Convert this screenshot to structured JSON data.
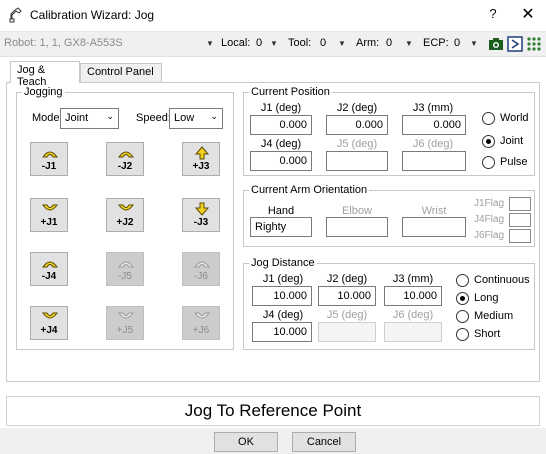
{
  "window": {
    "title": "Calibration Wizard: Jog",
    "help_label": "?",
    "close_label": "✕"
  },
  "toolbar": {
    "robot_label": "Robot:  1, 1, GX8-A553S",
    "local_label": "Local:",
    "local_value": "0",
    "tool_label": "Tool:",
    "tool_value": "0",
    "arm_label": "Arm:",
    "arm_value": "0",
    "ecp_label": "ECP:",
    "ecp_value": "0",
    "icons": [
      "camera-icon",
      "run-icon",
      "dots-grid-icon"
    ]
  },
  "tabs": [
    {
      "label": "Jog & Teach",
      "active": true
    },
    {
      "label": "Control Panel",
      "active": false
    }
  ],
  "jogging": {
    "group_title": "Jogging",
    "mode_label": "Mode:",
    "mode_value": "Joint",
    "speed_label": "Speed:",
    "speed_value": "Low",
    "buttons": [
      {
        "label": "-J1",
        "enabled": true
      },
      {
        "label": "-J2",
        "enabled": true
      },
      {
        "label": "+J3",
        "enabled": true
      },
      {
        "label": "+J1",
        "enabled": true
      },
      {
        "label": "+J2",
        "enabled": true
      },
      {
        "label": "-J3",
        "enabled": true
      },
      {
        "label": "-J4",
        "enabled": true
      },
      {
        "label": "-J5",
        "enabled": false
      },
      {
        "label": "-J6",
        "enabled": false
      },
      {
        "label": "+J4",
        "enabled": true
      },
      {
        "label": "+J5",
        "enabled": false
      },
      {
        "label": "+J6",
        "enabled": false
      }
    ]
  },
  "current_position": {
    "group_title": "Current Position",
    "fields": [
      {
        "label": "J1 (deg)",
        "value": "0.000",
        "enabled": true
      },
      {
        "label": "J2 (deg)",
        "value": "0.000",
        "enabled": true
      },
      {
        "label": "J3 (mm)",
        "value": "0.000",
        "enabled": true
      },
      {
        "label": "J4 (deg)",
        "value": "0.000",
        "enabled": true
      },
      {
        "label": "J5 (deg)",
        "value": "",
        "enabled": false
      },
      {
        "label": "J6 (deg)",
        "value": "",
        "enabled": false
      }
    ],
    "modes": [
      {
        "label": "World",
        "checked": false
      },
      {
        "label": "Joint",
        "checked": true
      },
      {
        "label": "Pulse",
        "checked": false
      }
    ]
  },
  "arm_orientation": {
    "group_title": "Current Arm Orientation",
    "hand_label": "Hand",
    "hand_value": "Righty",
    "elbow_label": "Elbow",
    "wrist_label": "Wrist",
    "flags": [
      "J1Flag",
      "J4Flag",
      "J6Flag"
    ]
  },
  "jog_distance": {
    "group_title": "Jog Distance",
    "fields": [
      {
        "label": "J1 (deg)",
        "value": "10.000",
        "enabled": true
      },
      {
        "label": "J2 (deg)",
        "value": "10.000",
        "enabled": true
      },
      {
        "label": "J3 (mm)",
        "value": "10.000",
        "enabled": true
      },
      {
        "label": "J4 (deg)",
        "value": "10.000",
        "enabled": true
      },
      {
        "label": "J5 (deg)",
        "value": "",
        "enabled": false
      },
      {
        "label": "J6 (deg)",
        "value": "",
        "enabled": false
      }
    ],
    "modes": [
      {
        "label": "Continuous",
        "checked": false
      },
      {
        "label": "Long",
        "checked": true
      },
      {
        "label": "Medium",
        "checked": false
      },
      {
        "label": "Short",
        "checked": false
      }
    ]
  },
  "reference_text": "Jog To Reference Point",
  "buttons": {
    "ok_label": "OK",
    "cancel_label": "Cancel"
  }
}
